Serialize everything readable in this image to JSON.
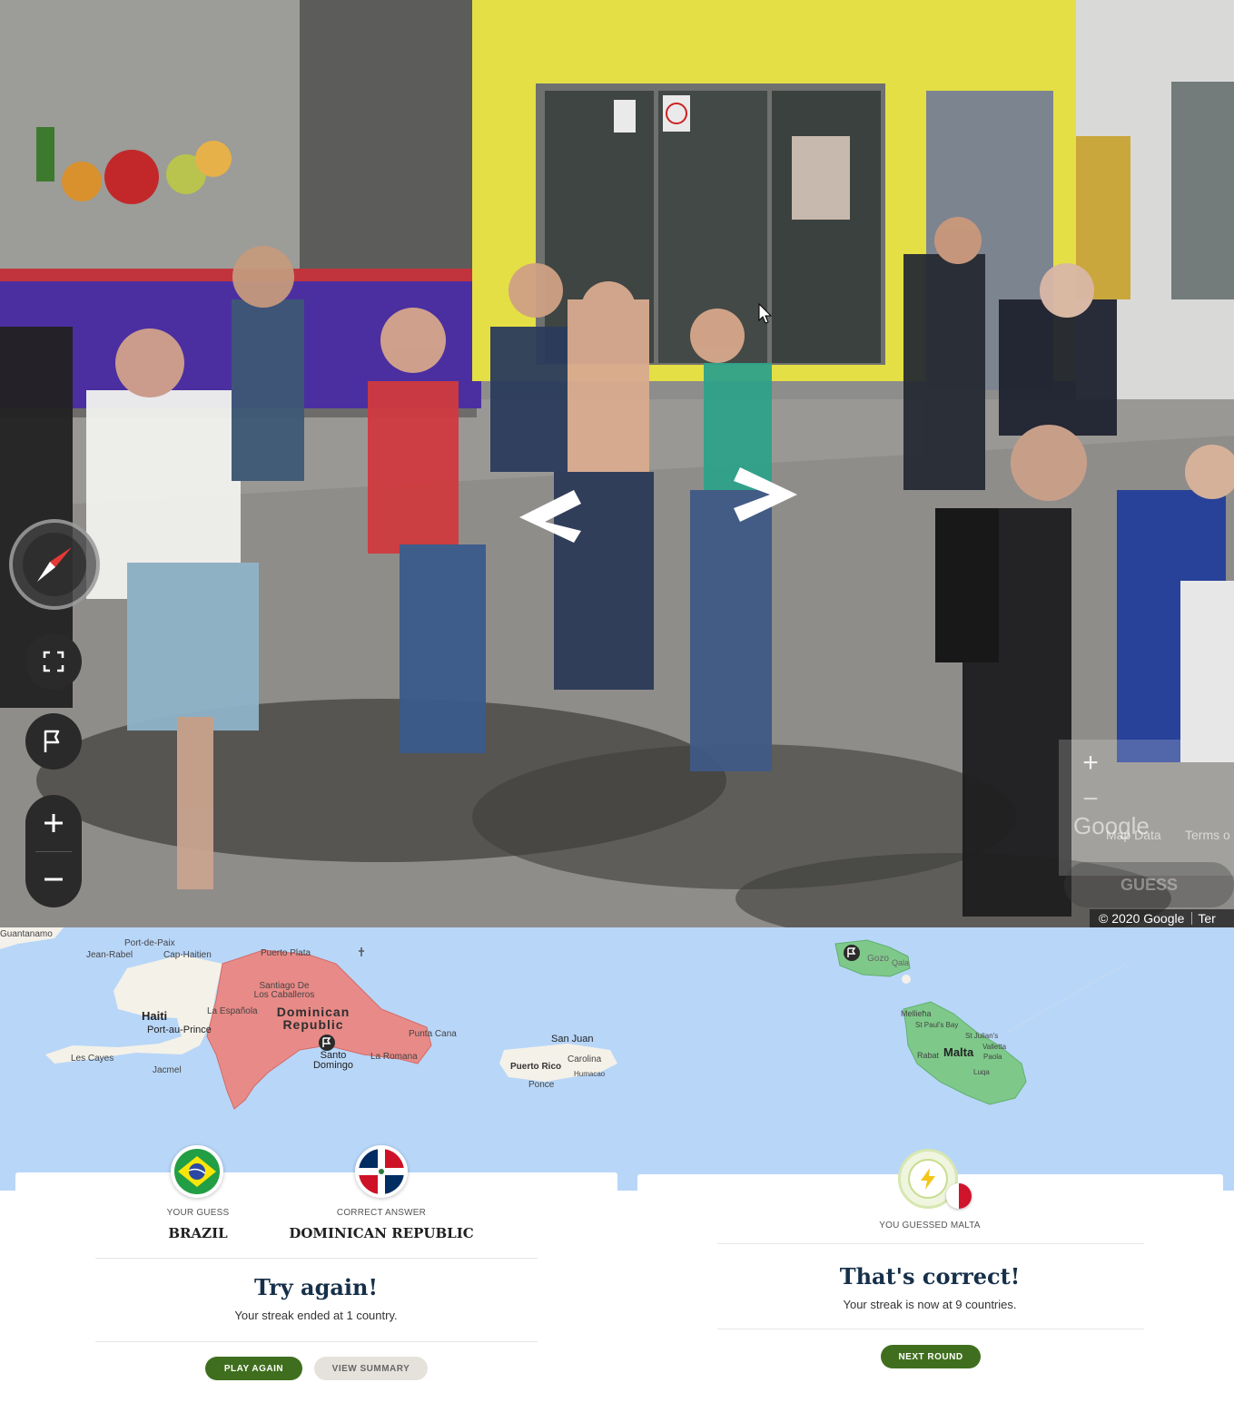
{
  "street_view": {
    "map_attribution": "© 2020 Google",
    "terms_short": "Ter",
    "overlay": {
      "zoom_in": "+",
      "zoom_out": "−",
      "logo": "Google",
      "map_data": "Map Data",
      "terms": "Terms o",
      "guess_button": "GUESS"
    },
    "controls": {
      "compass": "compass-icon",
      "fullscreen": "fullscreen-icon",
      "flag": "flag-icon",
      "zoom_in": "plus-icon",
      "zoom_out": "minus-icon"
    },
    "pan_arrows": [
      "chevron-left-icon",
      "chevron-right-icon"
    ]
  },
  "left_result": {
    "map_labels": {
      "guantanamo": "Guantanamo",
      "port_de_paix": "Port-de-Paix",
      "jean_rabel": "Jean-Rabel",
      "cap_haitien": "Cap-Haitien",
      "puerto_plata": "Puerto Plata",
      "santiago": "Santiago De Los Caballeros",
      "haiti": "Haiti",
      "la_espanola": "La Española",
      "port_au_prince": "Port-au-Prince",
      "dominican_republic": "Dominican Republic",
      "punta_cana": "Punta Cana",
      "santo_domingo": "Santo Domingo",
      "la_romana": "La Romana",
      "les_cayes": "Les Cayes",
      "jacmel": "Jacmel",
      "san_juan": "San Juan",
      "puerto_rico": "Puerto Rico",
      "carolina": "Carolina",
      "humacao": "Humacao",
      "ponce": "Ponce"
    },
    "your_guess_label": "YOUR GUESS",
    "your_guess": "BRAZIL",
    "correct_answer_label": "CORRECT ANSWER",
    "correct_answer": "DOMINICAN REPUBLIC",
    "title": "Try again!",
    "subtitle": "Your streak ended at 1 country.",
    "play_again": "PLAY AGAIN",
    "view_summary": "VIEW SUMMARY"
  },
  "right_result": {
    "map_labels": {
      "gozo": "Gozo",
      "qala": "Qala",
      "mellieha": "Mellieħa",
      "st_pauls_bay": "St Paul's Bay",
      "st_julians": "St Julian's",
      "valletta": "Valletta",
      "rabat": "Rabat",
      "malta": "Malta",
      "paola": "Paola",
      "luqa": "Luqa"
    },
    "guessed_label": "YOU GUESSED MALTA",
    "title": "That's correct!",
    "subtitle": "Your streak is now at 9 countries.",
    "next_round": "NEXT ROUND",
    "badge_icon": "lightning-icon"
  },
  "colors": {
    "map_water": "#b8d6f8",
    "wrong_country": "#e88a87",
    "right_country": "#7ec98a",
    "primary_button": "#3f6f1e",
    "title_text": "#17304a",
    "storefront_yellow": "#e4df45"
  }
}
